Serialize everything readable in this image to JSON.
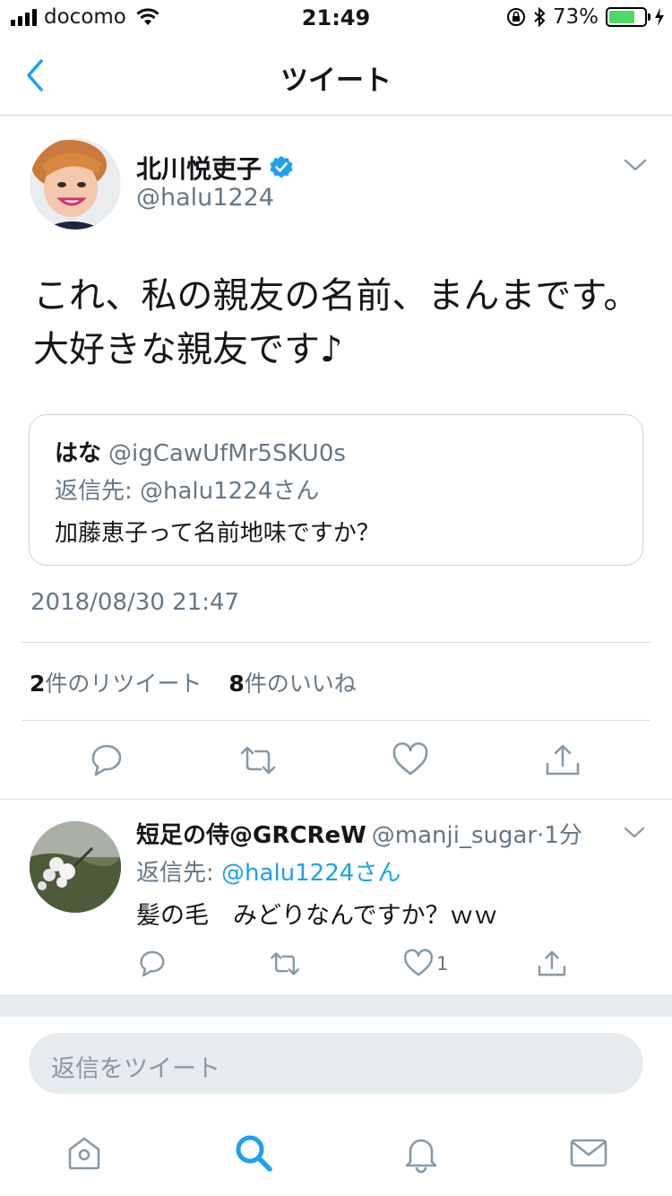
{
  "status_bar": {
    "carrier": "docomo",
    "time": "21:49",
    "battery_percent": "73%",
    "battery_level": 0.73,
    "battery_color": "#4cd964"
  },
  "nav": {
    "title": "ツイート",
    "back_icon": "chevron-left-icon"
  },
  "tweet": {
    "author_name": "北川悦吏子",
    "verified": true,
    "handle": "@halu1224",
    "text": "これ、私の親友の名前、まんまです。大好きな親友です♪",
    "quoted": {
      "name": "はな",
      "handle": "@igCawUfMr5SKU0s",
      "reply_to": "返信先: @halu1224さん",
      "text": "加藤恵子って名前地味ですか？"
    },
    "timestamp": "2018/08/30 21:47",
    "retweet_count": "2",
    "retweet_label": "件のリツイート",
    "like_count": "8",
    "like_label": "件のいいね"
  },
  "reply": {
    "name": "短足の侍@GRCReW",
    "handle": "@manji_sugar",
    "time": "·1分",
    "reply_to_prefix": "返信先: ",
    "reply_to_mention": "@halu1224さん",
    "text": "髪の毛　みどりなんですか？ｗｗ",
    "like_count": "1"
  },
  "composer": {
    "placeholder": "返信をツイート"
  },
  "tabbar": {
    "items": [
      "home-icon",
      "search-icon",
      "notifications-icon",
      "messages-icon"
    ]
  },
  "colors": {
    "accent": "#1da1f2",
    "secondary_text": "#657786",
    "icon_gray": "#8899a6"
  }
}
